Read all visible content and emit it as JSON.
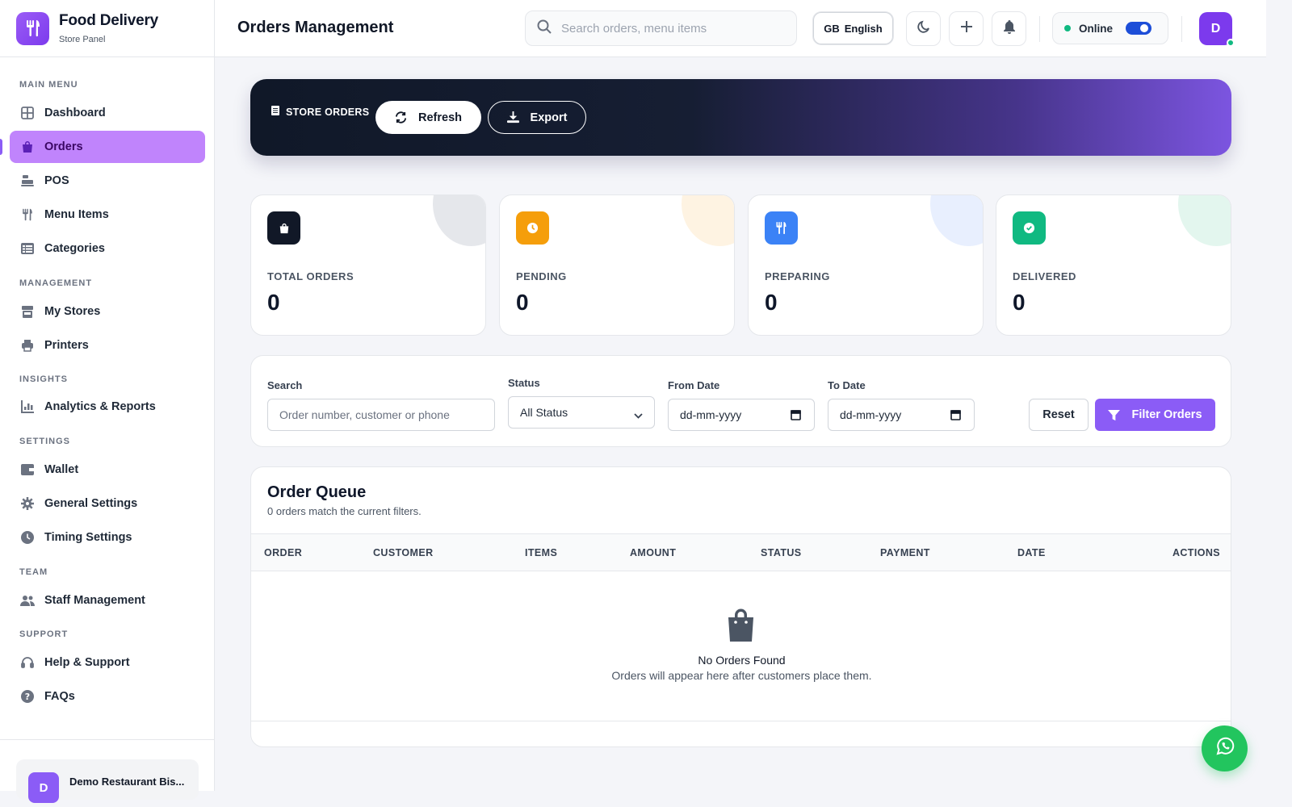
{
  "brand": {
    "name": "Food Delivery",
    "subtitle": "Store Panel",
    "icon": "utensils-icon"
  },
  "sidebar": {
    "sections": {
      "main": "MAIN MENU",
      "management": "MANAGEMENT",
      "insights": "INSIGHTS",
      "settings": "SETTINGS",
      "team": "TEAM",
      "support": "SUPPORT"
    },
    "items": [
      {
        "label": "Dashboard",
        "icon": "grid-icon"
      },
      {
        "label": "Orders",
        "icon": "shopping-bag-icon",
        "active": true
      },
      {
        "label": "POS",
        "icon": "cash-register-icon"
      },
      {
        "label": "Menu Items",
        "icon": "utensils-icon"
      },
      {
        "label": "Categories",
        "icon": "list-icon"
      },
      {
        "label": "My Stores",
        "icon": "store-icon"
      },
      {
        "label": "Printers",
        "icon": "printer-icon"
      },
      {
        "label": "Analytics & Reports",
        "icon": "chart-icon"
      },
      {
        "label": "Wallet",
        "icon": "wallet-icon"
      },
      {
        "label": "General Settings",
        "icon": "gear-icon"
      },
      {
        "label": "Timing Settings",
        "icon": "clock-icon"
      },
      {
        "label": "Staff Management",
        "icon": "users-icon"
      },
      {
        "label": "Help & Support",
        "icon": "headset-icon"
      },
      {
        "label": "FAQs",
        "icon": "question-icon"
      }
    ],
    "store": {
      "avatar": "D",
      "name": "Demo Restaurant Bis..."
    }
  },
  "header": {
    "title": "Orders Management",
    "search_placeholder": "Search orders, menu items",
    "language_flag": "GB",
    "language": "English",
    "status": "Online",
    "status_on": true,
    "avatar": "D"
  },
  "hero": {
    "label": "STORE ORDERS",
    "refresh_label": "Refresh",
    "export_label": "Export"
  },
  "stats": [
    {
      "label": "TOTAL ORDERS",
      "value": "0",
      "color": "#111827",
      "icon": "shopping-bag-icon"
    },
    {
      "label": "PENDING",
      "value": "0",
      "color": "#f59e0b",
      "icon": "clock-icon"
    },
    {
      "label": "PREPARING",
      "value": "0",
      "color": "#3b82f6",
      "icon": "utensils-icon"
    },
    {
      "label": "DELIVERED",
      "value": "0",
      "color": "#10b981",
      "icon": "check-circle-icon"
    }
  ],
  "filters": {
    "search_label": "Search",
    "search_placeholder": "Order number, customer or phone",
    "status_label": "Status",
    "status_value": "All Status",
    "from_label": "From Date",
    "from_placeholder": "dd-mm-yyyy",
    "to_label": "To Date",
    "to_placeholder": "dd-mm-yyyy",
    "reset_label": "Reset",
    "filter_label": "Filter Orders"
  },
  "queue": {
    "title": "Order Queue",
    "subtitle": "0 orders match the current filters.",
    "columns": [
      "ORDER",
      "CUSTOMER",
      "ITEMS",
      "AMOUNT",
      "STATUS",
      "PAYMENT",
      "DATE",
      "ACTIONS"
    ],
    "empty_title": "No Orders Found",
    "empty_subtitle": "Orders will appear here after customers place them."
  },
  "colors": {
    "accent": "#8b5cf6",
    "active_nav": "#c084fc",
    "online": "#10b981",
    "whatsapp": "#22c55e"
  }
}
